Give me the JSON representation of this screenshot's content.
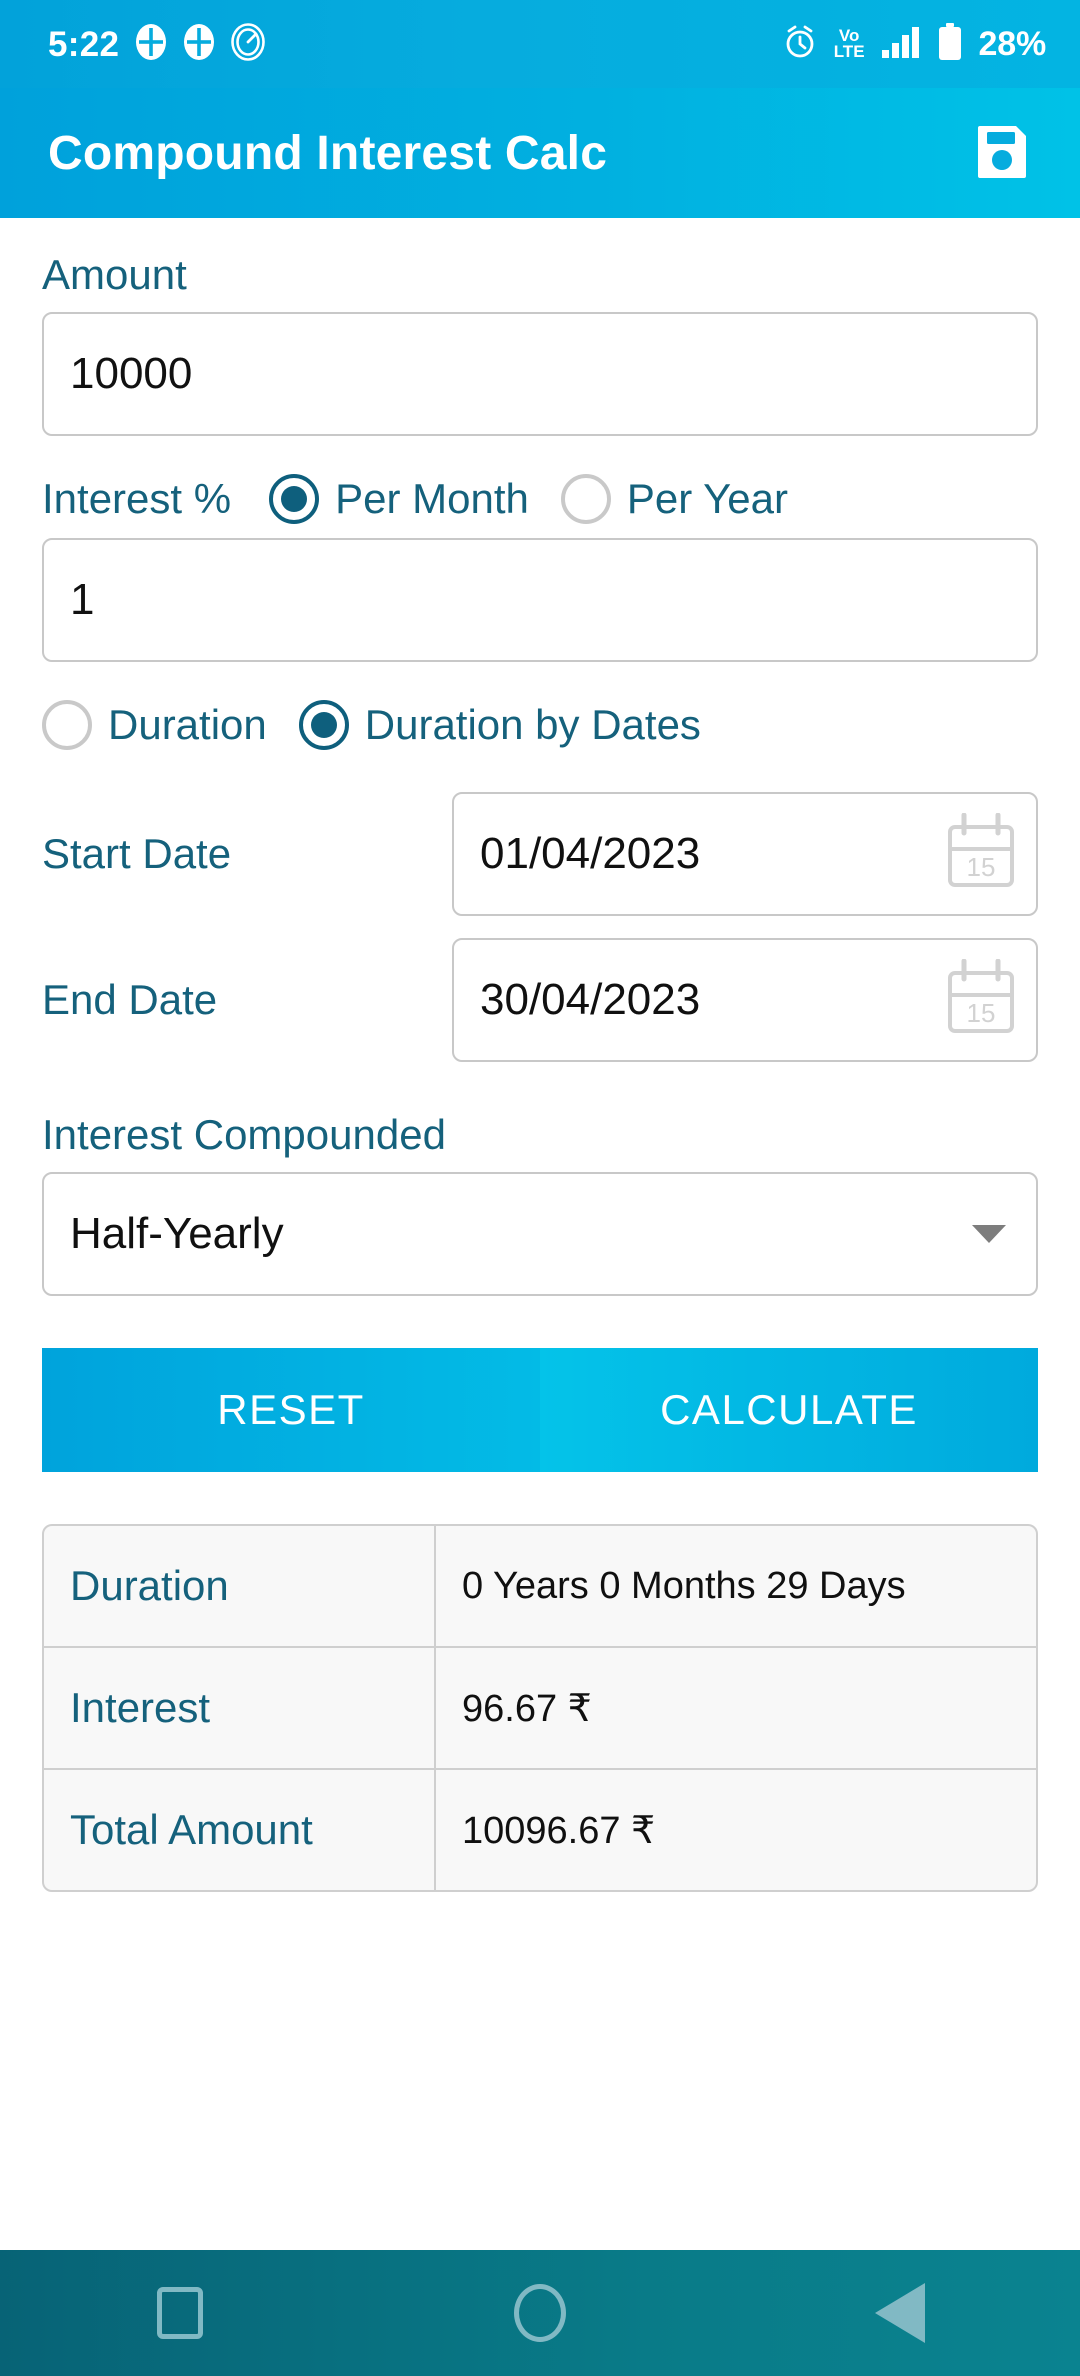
{
  "status_bar": {
    "time": "5:22",
    "left_icons": [
      "app-badge-icon",
      "app-badge-icon",
      "speedometer-icon"
    ],
    "alarm_icon": "alarm-clock-icon",
    "network_label_top": "Vo",
    "network_label_bottom": "LTE",
    "signal_icon": "signal-bars-icon",
    "battery_icon": "battery-icon",
    "battery_text": "28%"
  },
  "app_bar": {
    "title": "Compound Interest Calc",
    "save_icon": "save-floppy-icon"
  },
  "form": {
    "amount": {
      "label": "Amount",
      "value": "10000",
      "placeholder": "Amount"
    },
    "interest": {
      "label": "Interest %",
      "value": "1",
      "placeholder": "Interest %",
      "options": [
        {
          "label": "Per Month",
          "selected": true
        },
        {
          "label": "Per Year",
          "selected": false
        }
      ]
    },
    "duration_mode": [
      {
        "label": "Duration",
        "selected": false
      },
      {
        "label": "Duration by Dates",
        "selected": true
      }
    ],
    "start_date": {
      "label": "Start Date",
      "value": "01/04/2023",
      "icon": "calendar-icon",
      "icon_day": "15"
    },
    "end_date": {
      "label": "End Date",
      "value": "30/04/2023",
      "icon": "calendar-icon",
      "icon_day": "15"
    },
    "compounded": {
      "label": "Interest Compounded",
      "value": "Half-Yearly"
    }
  },
  "actions": {
    "reset": "RESET",
    "calculate": "CALCULATE"
  },
  "results": {
    "rows": [
      {
        "key": "Duration",
        "value": "0 Years 0 Months 29 Days"
      },
      {
        "key": "Interest",
        "value": "96.67 ₹"
      },
      {
        "key": "Total Amount",
        "value": "10096.67 ₹"
      }
    ]
  },
  "nav_bar": {
    "recents": "recents-square-icon",
    "home": "home-circle-icon",
    "back": "back-triangle-icon"
  },
  "colors": {
    "accent_cyan": "#00aadd",
    "accent_cyan_light": "#00c2e7",
    "label_teal": "#15617c",
    "nav_bg": "#097b88"
  }
}
